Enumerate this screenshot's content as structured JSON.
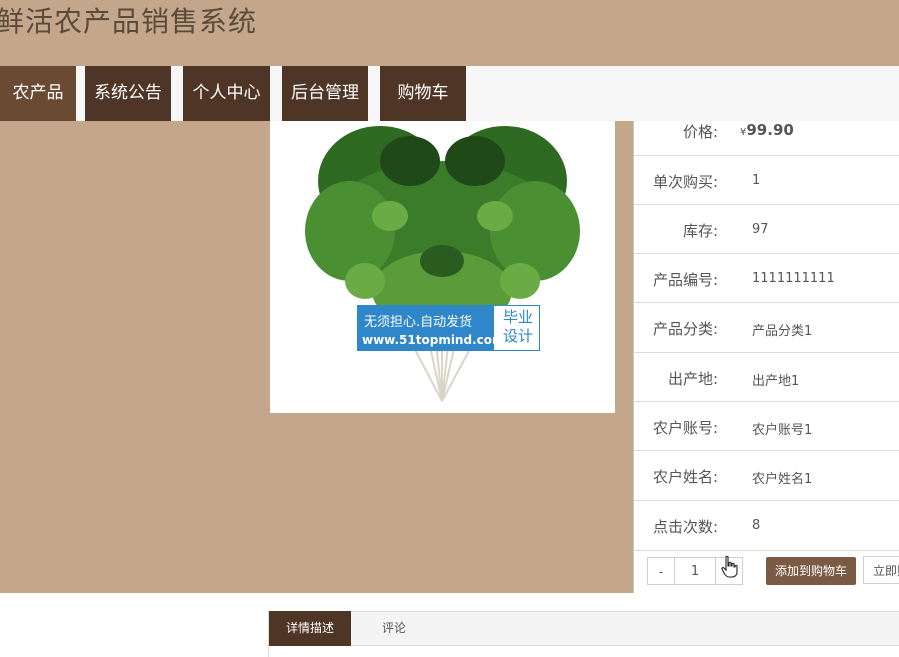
{
  "header": {
    "title": "鲜活农产品销售系统"
  },
  "nav": {
    "items": [
      {
        "label": "农产品"
      },
      {
        "label": "系统公告"
      },
      {
        "label": "个人中心"
      },
      {
        "label": "后台管理"
      },
      {
        "label": "购物车"
      }
    ]
  },
  "product": {
    "image_alt": "fresh coriander",
    "watermark": {
      "line1": "无须担心.自动发货",
      "line2": "www.51topmind.com",
      "right": [
        "毕业",
        "设计"
      ]
    },
    "details": [
      {
        "label": "价格:",
        "currency": "¥",
        "value": "99.90"
      },
      {
        "label": "单次购买:",
        "value": "1"
      },
      {
        "label": "库存:",
        "value": "97"
      },
      {
        "label": "产品编号:",
        "value": "1111111111"
      },
      {
        "label": "产品分类:",
        "value": "产品分类1"
      },
      {
        "label": "出产地:",
        "value": "出产地1"
      },
      {
        "label": "农户账号:",
        "value": "农户账号1"
      },
      {
        "label": "农户姓名:",
        "value": "农户姓名1"
      },
      {
        "label": "点击次数:",
        "value": "8"
      }
    ],
    "quantity": {
      "minus": "-",
      "value": "1",
      "plus": "+"
    },
    "add_to_cart_label": "添加到购物车",
    "buy_now_label": "立即购买"
  },
  "tabs": [
    {
      "label": "详情描述",
      "active": true
    },
    {
      "label": "评论",
      "active": false
    }
  ],
  "colors": {
    "header_bg": "#c4a78a",
    "nav_item_bg": "#4f3526",
    "accent_button": "#7a5a42",
    "watermark_blue": "#2f86c9"
  }
}
